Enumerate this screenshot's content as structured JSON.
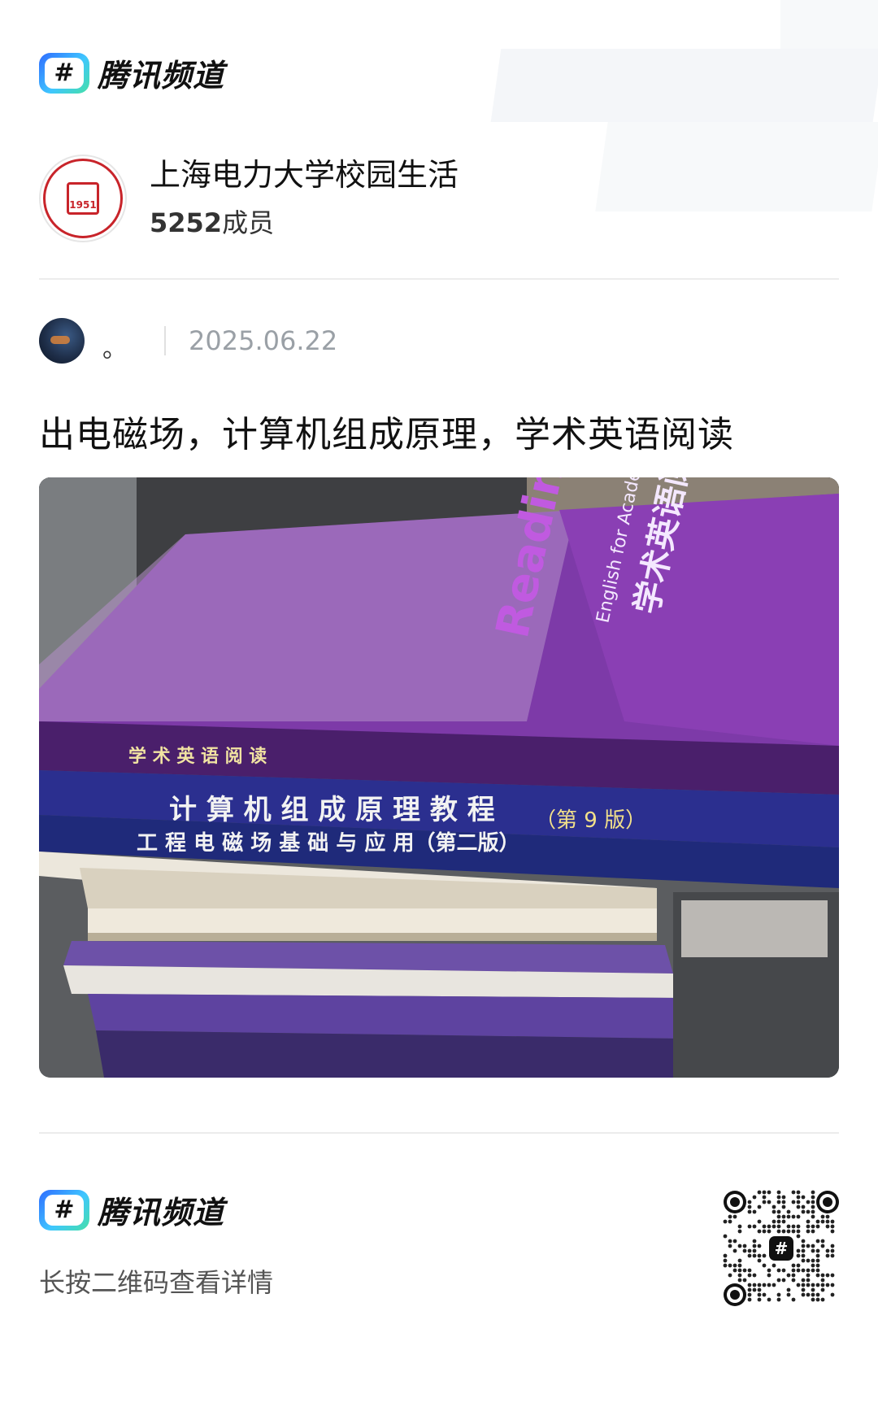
{
  "brand": {
    "name": "腾讯频道",
    "logo_glyph": "#"
  },
  "channel": {
    "name": "上海电力大学校园生活",
    "members_count": "5252",
    "members_suffix": "成员",
    "avatar_icon": "university-seal-icon"
  },
  "post": {
    "author": "。",
    "date": "2025.06.22",
    "title": "出电磁场，计算机组成原理，学术英语阅读",
    "photo": {
      "alt_icon": "stacked-textbooks-photo",
      "book_spines": [
        "学术英语阅读",
        "计算机组成原理教程（第9版）",
        "工程电磁场基础与应用（第二版）"
      ],
      "cover_texts": [
        "Reading",
        "English for Academic Study",
        "学术英语阅读"
      ]
    }
  },
  "footer": {
    "brand_name": "腾讯频道",
    "tip": "长按二维码查看详情",
    "qr_icon": "qr-code-icon"
  },
  "colors": {
    "accent_blue": "#2f6bff",
    "seal_red": "#c8242a",
    "book_purple": "#7a3aa6",
    "book_blue": "#2b2f8f"
  }
}
